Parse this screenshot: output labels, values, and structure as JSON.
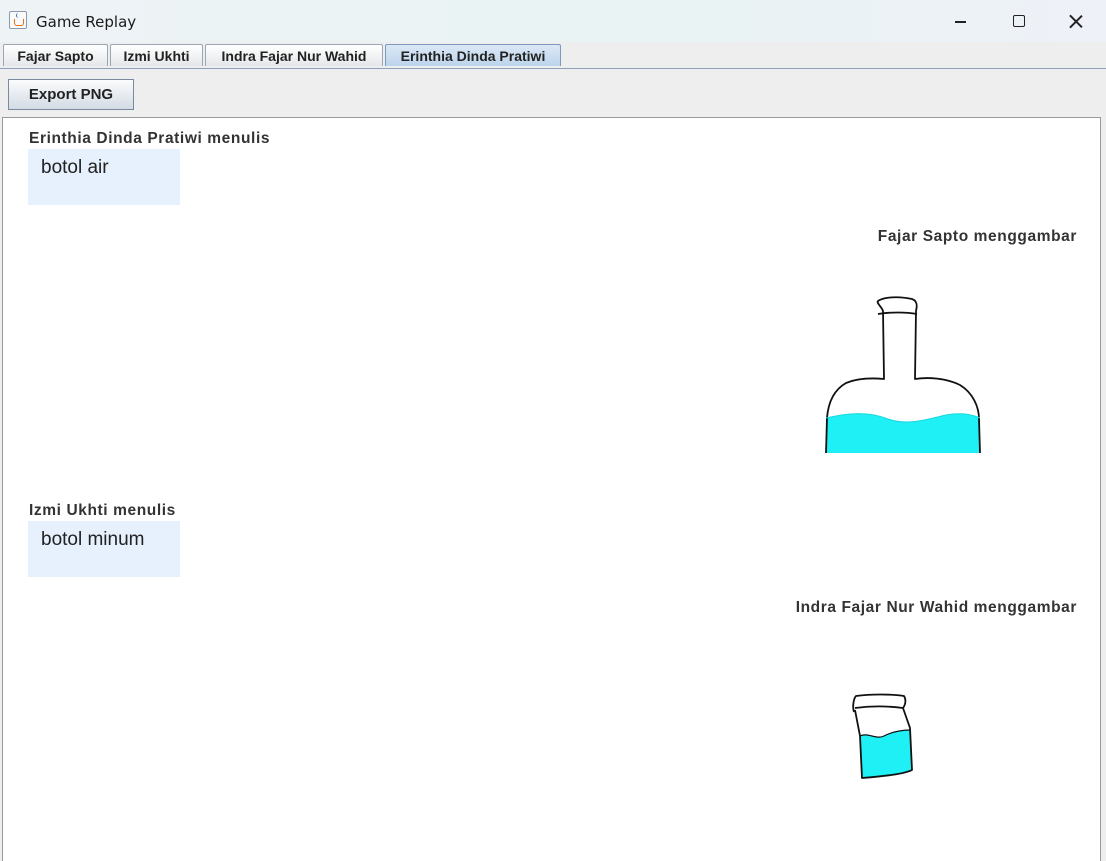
{
  "window": {
    "title": "Game Replay",
    "icon": "java-cup-icon"
  },
  "tabs": [
    {
      "label": "Fajar Sapto",
      "selected": false
    },
    {
      "label": "Izmi Ukhti",
      "selected": false
    },
    {
      "label": "Indra Fajar Nur Wahid",
      "selected": false
    },
    {
      "label": "Erinthia Dinda Pratiwi",
      "selected": true
    }
  ],
  "toolbar": {
    "export_label": "Export PNG"
  },
  "replay": {
    "entries": [
      {
        "type": "write",
        "label": "Erinthia Dinda Pratiwi menulis",
        "text": "botol air"
      },
      {
        "type": "draw",
        "label": "Fajar Sapto menggambar",
        "drawing": "bottle-drawing"
      },
      {
        "type": "write",
        "label": "Izmi Ukhti menulis",
        "text": "botol minum"
      },
      {
        "type": "draw",
        "label": "Indra Fajar Nur Wahid menggambar",
        "drawing": "cup-drawing"
      }
    ]
  },
  "colors": {
    "water": "#1ff0f5",
    "written_box": "#e7f0fd",
    "selected_tab": "#c9dcf1"
  }
}
